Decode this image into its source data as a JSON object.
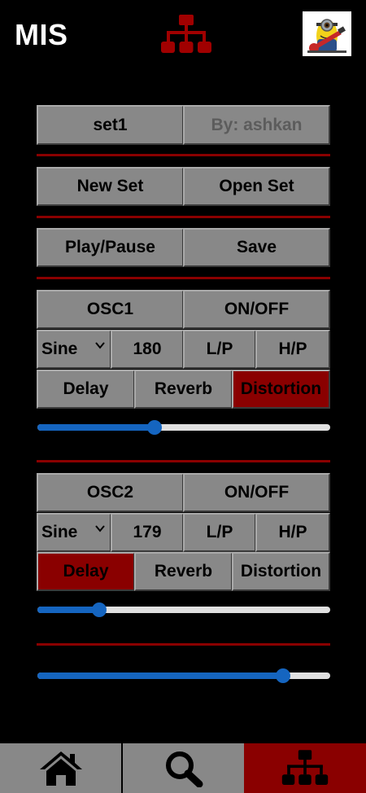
{
  "header": {
    "title": "MIS",
    "icon": "sitemap-icon",
    "avatar_alt": "minion-avatar"
  },
  "set_row": {
    "name": "set1",
    "author": "By: ashkan"
  },
  "actions": {
    "new_set": "New Set",
    "open_set": "Open Set",
    "play_pause": "Play/Pause",
    "save": "Save"
  },
  "osc1": {
    "title": "OSC1",
    "toggle": "ON/OFF",
    "wave": "Sine",
    "freq": "180",
    "lp": "L/P",
    "hp": "H/P",
    "delay": "Delay",
    "reverb": "Reverb",
    "distortion": "Distortion",
    "active_effect": "Distortion",
    "slider_value": 0.4
  },
  "osc2": {
    "title": "OSC2",
    "toggle": "ON/OFF",
    "wave": "Sine",
    "freq": "179",
    "lp": "L/P",
    "hp": "H/P",
    "delay": "Delay",
    "reverb": "Reverb",
    "distortion": "Distortion",
    "active_effect": "Delay",
    "slider_value": 0.21
  },
  "master": {
    "slider_value": 0.84
  },
  "tabs": [
    {
      "icon": "home-icon",
      "active": false
    },
    {
      "icon": "search-icon",
      "active": false
    },
    {
      "icon": "sitemap-icon",
      "active": true
    }
  ],
  "colors": {
    "accent": "#8a0000",
    "button": "#888888",
    "slider": "#1565c0"
  }
}
